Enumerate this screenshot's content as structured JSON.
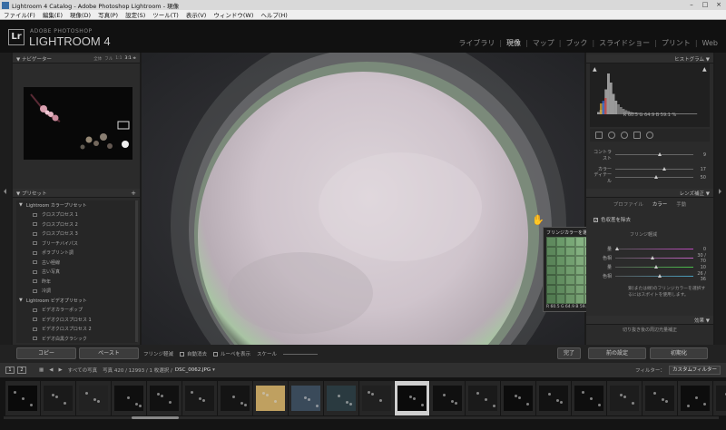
{
  "window": {
    "title": "Lightroom 4 Catalog - Adobe Photoshop Lightroom - 現像",
    "controls": [
      "–",
      "□",
      "×"
    ]
  },
  "menu": [
    "ファイル(F)",
    "編集(E)",
    "現像(D)",
    "写真(P)",
    "設定(S)",
    "ツール(T)",
    "表示(V)",
    "ウィンドウ(W)",
    "ヘルプ(H)"
  ],
  "header": {
    "logo": "Lr",
    "brand_top": "ADOBE PHOTOSHOP",
    "brand": "LIGHTROOM 4",
    "modules": [
      "ライブラリ",
      "現像",
      "マップ",
      "ブック",
      "スライドショー",
      "プリント",
      "Web"
    ],
    "active_module": "現像"
  },
  "left": {
    "navigator": {
      "title": "ナビゲーター",
      "zoom_options": [
        "全体",
        "フル",
        "1:1",
        "3:1 ≑"
      ]
    },
    "presets": {
      "title": "プリセット",
      "add_label": "+",
      "folders": [
        {
          "name": "Lightroom カラープリセット",
          "items": [
            "クロスプロセス 1",
            "クロスプロセス 2",
            "クロスプロセス 3",
            "ブリーチバイパス",
            "ポラプリント調",
            "古い極線",
            "古い写真",
            "昨年",
            "冷調"
          ]
        },
        {
          "name": "Lightroom ビデオプリセット",
          "items": [
            "ビデオカラーポップ",
            "ビデオクロスプロセス 1",
            "ビデオクロスプロセス 2",
            "ビデオ白黒クラシック"
          ]
        }
      ]
    },
    "copy_button": "コピー",
    "paste_button": "ペースト"
  },
  "loupe": {
    "title": "フリンジカラーを選択：",
    "rgb": "R 60.5   G 64.9   B 59.1 %",
    "cells": [
      "#5f8a5e",
      "#6b9a6a",
      "#78a776",
      "#86b383",
      "#93bf90",
      "#a1c99d",
      "#aed3aa",
      "#5c875b",
      "#689667",
      "#76a373",
      "#82af7f",
      "#90ba8c",
      "#9dc598",
      "#aacfa5",
      "#5a8459",
      "#669364",
      "#729f70",
      "#80ab7c",
      "#8cb688",
      "#99c194",
      "#a6cba1",
      "#588257",
      "#648f62",
      "#709c6d",
      "#7ca879",
      "#8ab385",
      "#96be91",
      "#a3c89d",
      "#567f55",
      "#628d60",
      "#6e996b",
      "#7aa577",
      "#87b082",
      "#94bb8e",
      "#a0c59a",
      "#547d53",
      "#5f8a5e",
      "#6c9669",
      "#78a274",
      "#85ad80",
      "#91b88b",
      "#9ec297",
      "#527b51",
      "#5d875c",
      "#6a9467",
      "#76a072",
      "#83ab7e",
      "#8fb689",
      "#9bc094"
    ]
  },
  "right": {
    "histogram": {
      "title": "ヒストグラム",
      "rgb_readout": "R 60.5   G 64.9   B 59.1 %",
      "bars": [
        0.05,
        0.1,
        0.25,
        0.55,
        0.9,
        0.7,
        0.45,
        0.3,
        0.22,
        0.16,
        0.12,
        0.09,
        0.07,
        0.05,
        0.04,
        0.03,
        0.03,
        0.02,
        0.02,
        0.02,
        0.02,
        0.02,
        0.02,
        0.02,
        0.02,
        0.02,
        0.02,
        0.02,
        0.02,
        0.02,
        0.02,
        0.02,
        0.02,
        0.02,
        0.02,
        0.02,
        0.02,
        0.02,
        0.02,
        0.02
      ]
    },
    "basic_sliders": [
      {
        "label": "コントラスト",
        "value": "9",
        "pos": 0.55
      },
      {
        "label": "カラー",
        "value": "17",
        "pos": 0.6
      },
      {
        "label": "ディテール",
        "value": "50",
        "pos": 0.5
      }
    ],
    "lens": {
      "title": "レンズ補正",
      "tabs": [
        "プロファイル",
        "カラー",
        "手動"
      ],
      "active_tab": "カラー",
      "remove_ca": "色収差を除去",
      "fringe_title": "フリンジ軽減",
      "sliders": [
        {
          "label": "量",
          "value": "0",
          "pos": 0.0,
          "color": "#c04ac0"
        },
        {
          "label": "色相",
          "value": "30 / 70",
          "pos": 0.45,
          "color": "#c060c0"
        },
        {
          "label": "量",
          "value": "10",
          "pos": 0.5,
          "color": "#4ac04a"
        },
        {
          "label": "色相",
          "value": "26 / 36",
          "pos": 0.55,
          "color": "#4aa0c0"
        }
      ],
      "hint": "紫(または緑)のフリンジカラーを選択するにはスポイトを使用します。"
    },
    "effects": {
      "title": "効果",
      "vignette": "切り抜き後の周辺光量補正"
    },
    "prev_button": "前の設定",
    "reset_button": "初期化"
  },
  "toolbar": {
    "fringe_label": "フリンジ軽減",
    "auto_dismiss": "自動消去",
    "show_loupe": "ルーペを表示",
    "scale": "スケール",
    "done": "完了"
  },
  "filmstrip_bar": {
    "screens": [
      "1",
      "2"
    ],
    "source": "すべての写真",
    "count": "写真 420 / 12993 / 1 枚選択 /",
    "filename": "DSC_0062.JPG",
    "filter_label": "フィルター：",
    "filter_value": "カスタムフィルター"
  },
  "filmstrip": {
    "thumbs": [
      0,
      1,
      2,
      3,
      4,
      5,
      6,
      7,
      8,
      9,
      10,
      11,
      12,
      13,
      14,
      15,
      16,
      17,
      18,
      19,
      20
    ],
    "selected": 11
  }
}
